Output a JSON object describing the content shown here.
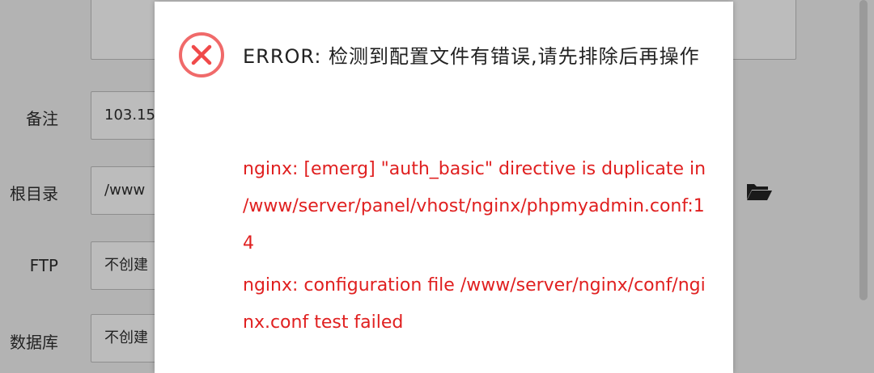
{
  "form": {
    "remark_label": "备注",
    "remark_value": "103.15",
    "rootdir_label": "根目录",
    "rootdir_value": "/www",
    "ftp_label": "FTP",
    "ftp_value": "不创建",
    "db_label": "数据库",
    "db_value": "不创建"
  },
  "dialog": {
    "title": "ERROR: 检测到配置文件有错误,请先排除后再操作",
    "error_line1": "nginx: [emerg] \"auth_basic\" directive is duplicate in /www/server/panel/vhost/nginx/phpmyadmin.conf:14",
    "error_line2": "nginx: configuration file /www/server/nginx/conf/nginx.conf test failed"
  },
  "colors": {
    "error_red": "#e02020",
    "overlay": "#b3b3b3"
  },
  "icons": {
    "error": "error-circle-x-icon",
    "folder": "folder-open-icon"
  }
}
